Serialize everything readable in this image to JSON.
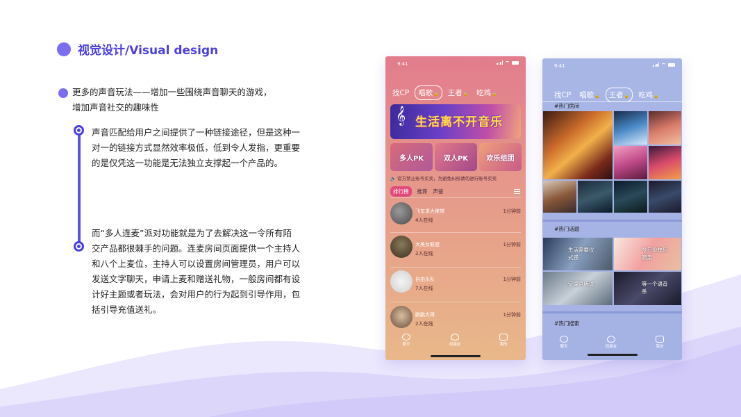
{
  "section": {
    "title": "视觉设计/Visual design"
  },
  "intro": {
    "bullet": "更多的声音玩法——增加一些围绕声音聊天的游戏，增加声音社交的趣味性"
  },
  "timeline": {
    "para1": "声音匹配给用户之间提供了一种链接途径，但是这种一对一的链接方式显然效率极低，低到令人发指，更重要的是仅凭这一功能是无法独立支撑起一个产品的。",
    "para2": "而“多人连麦”派对功能就是为了去解决这一令所有陌交产品都很棘手的问题。连麦房间页面提供一个主持人和八个上麦位，主持人可以设置房间管理员，用户可以发送文字聊天，申请上麦和赠送礼物，一般房间都有设计好主题或者玩法，会对用户的行为起到引导作用，包括引导充值送礼。"
  },
  "phone1": {
    "status_time": "9:41",
    "tabs": [
      {
        "label": "找CP",
        "locked": false,
        "active": false
      },
      {
        "label": "唱歌",
        "locked": true,
        "active": true
      },
      {
        "label": "王者",
        "locked": true,
        "active": false
      },
      {
        "label": "吃鸡",
        "locked": true,
        "active": false
      }
    ],
    "banner_text": "生活离不开音乐",
    "modes": [
      "多人PK",
      "双人PK",
      "欢乐组团"
    ],
    "notice": "官方禁止账号买卖，为避免纠纷请勿进行账号买卖",
    "subtabs": [
      "排行榜",
      "推荐",
      "声鉴"
    ],
    "rooms": [
      {
        "name": "飞车求大佬带",
        "online": "4人在线",
        "time": "1分钟前"
      },
      {
        "name": "大美女联盟",
        "online": "2人在线",
        "time": "1分钟前"
      },
      {
        "name": "自由乐队",
        "online": "7人在线",
        "time": "1分钟前"
      },
      {
        "name": "鹏鹏大哥",
        "online": "2人在线",
        "time": "1分钟前"
      }
    ],
    "nav": [
      "聊天",
      "找朋友",
      "我的"
    ]
  },
  "phone2": {
    "status_time": "9:41",
    "tabs": [
      {
        "label": "找CP",
        "locked": false,
        "active": false
      },
      {
        "label": "唱歌",
        "locked": true,
        "active": false
      },
      {
        "label": "王者",
        "locked": true,
        "active": true
      },
      {
        "label": "吃鸡",
        "locked": true,
        "active": false
      }
    ],
    "hot_rooms": "#热门房间",
    "hot_topics": "#热门话题",
    "topics": [
      "生活需要仪式感",
      "今日份快乐源泉",
      "铲屎官听说",
      "等一个语音杀"
    ],
    "hot_search": "#热门搜索",
    "nav": [
      "聊天",
      "找朋友",
      "我的"
    ]
  },
  "colors": {
    "accent": "#4b3fe0",
    "dot": "#7b6ef5",
    "wave": "#e6e1fb"
  }
}
